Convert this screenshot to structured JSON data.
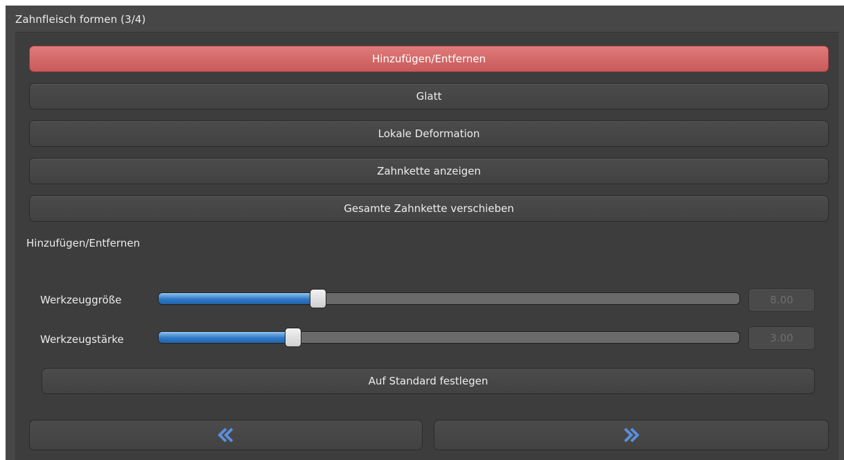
{
  "window": {
    "title": "Zahnfleisch formen (3/4)"
  },
  "tools": [
    {
      "label": "Hinzufügen/Entfernen",
      "active": true
    },
    {
      "label": "Glatt",
      "active": false
    },
    {
      "label": "Lokale Deformation",
      "active": false
    },
    {
      "label": "Zahnkette anzeigen",
      "active": false
    },
    {
      "label": "Gesamte Zahnkette verschieben",
      "active": false
    }
  ],
  "section_label": "Hinzufügen/Entfernen",
  "sliders": [
    {
      "label": "Werkzeuggröße",
      "value": "8.00",
      "fraction": 0.275
    },
    {
      "label": "Werkzeugstärke",
      "value": "3.00",
      "fraction": 0.232
    }
  ],
  "default_button": "Auf Standard festlegen",
  "navigation": {
    "back_icon": "double-chevron-left-icon",
    "forward_icon": "double-chevron-right-icon"
  },
  "colors": {
    "active_button": "#d96a6a",
    "slider_fill": "#2f79c8",
    "nav_arrow": "#5b8fdd"
  }
}
